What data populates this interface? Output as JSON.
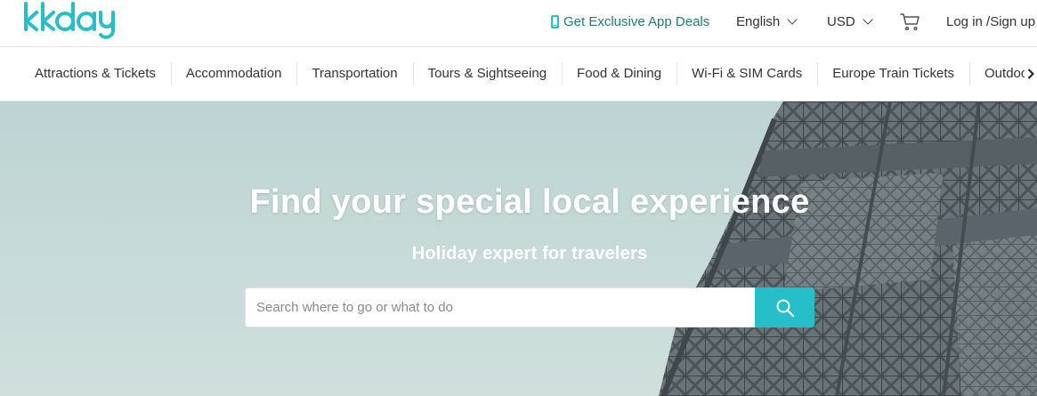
{
  "header": {
    "logo_text": "kkday",
    "app_deals_label": "Get Exclusive App Deals",
    "language_label": "English",
    "currency_label": "USD",
    "login_label": "Log in /Sign up"
  },
  "nav": {
    "items": [
      {
        "label": "Attractions & Tickets"
      },
      {
        "label": "Accommodation"
      },
      {
        "label": "Transportation"
      },
      {
        "label": "Tours & Sightseeing"
      },
      {
        "label": "Food & Dining"
      },
      {
        "label": "Wi-Fi & SIM Cards"
      },
      {
        "label": "Europe Train Tickets"
      },
      {
        "label": "Outdoor"
      }
    ]
  },
  "hero": {
    "title": "Find your special local experience",
    "subtitle": "Holiday expert for travelers",
    "search_placeholder": "Search where to go or what to do",
    "search_value": ""
  },
  "icons": {
    "phone": "phone-icon",
    "language_chevron": "chevron-down-icon",
    "currency_chevron": "chevron-down-icon",
    "cart": "cart-icon",
    "nav_scroll": "chevron-right-icon",
    "search": "search-icon"
  },
  "colors": {
    "brand": "#26bec9",
    "app_deals_text": "#1f7b7e",
    "hero_sky": "#c6dad7",
    "text": "#333333"
  }
}
